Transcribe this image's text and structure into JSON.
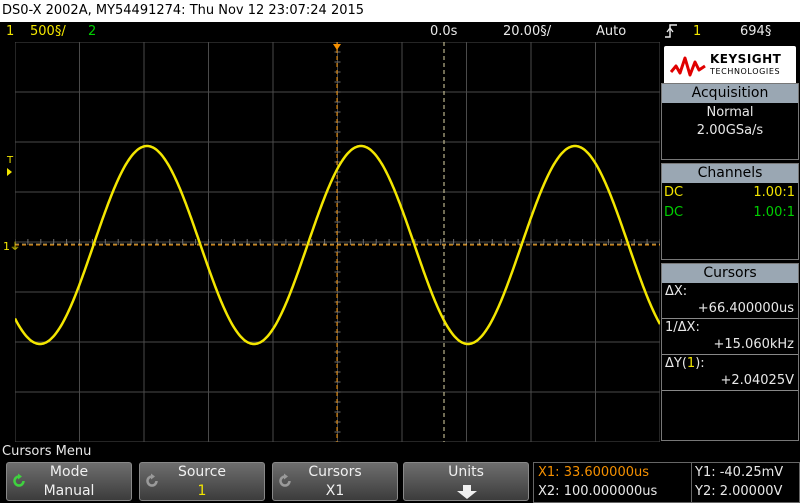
{
  "title": "DS0-X 2002A, MY54491274: Thu Nov 12 23:07:24 2015",
  "status": {
    "ch1_num": "1",
    "ch1_scale": "500§/",
    "ch2_num": "2",
    "time_delay": "0.0s",
    "time_scale": "20.00§/",
    "trigger_mode": "Auto",
    "trigger_icon": "rising-edge-trigger",
    "trigger_source": "1",
    "trigger_level": "694§"
  },
  "graticule": {
    "trigger_marker": "T",
    "ground_marker": "1"
  },
  "logo": {
    "line1": "KEYSIGHT",
    "line2": "TECHNOLOGIES"
  },
  "acquisition": {
    "header": "Acquisition",
    "mode": "Normal",
    "rate": "2.00GSa/s"
  },
  "channels": {
    "header": "Channels",
    "rows": [
      {
        "coupling": "DC",
        "probe": "1.00:1",
        "color": "#f3e600"
      },
      {
        "coupling": "DC",
        "probe": "1.00:1",
        "color": "#00d000"
      }
    ]
  },
  "cursors": {
    "header": "Cursors",
    "dx_label": "ΔX:",
    "dx_value": "+66.400000us",
    "inv_dx_label": "1/ΔX:",
    "inv_dx_value": "+15.060kHz",
    "dy_label_prefix": "ΔY(",
    "dy_label_src": "1",
    "dy_label_suffix": "):",
    "dy_value": "+2.04025V"
  },
  "menu": {
    "title": "Cursors Menu",
    "keys": [
      {
        "top": "Mode",
        "bottom": "Manual"
      },
      {
        "top": "Source",
        "bottom": "1"
      },
      {
        "top": "Cursors",
        "bottom": "X1"
      },
      {
        "top": "Units",
        "bottom": ""
      }
    ]
  },
  "readout": {
    "x1": "X1: 33.600000us",
    "x2": "X2: 100.000000us",
    "y1": "Y1: -40.25mV",
    "y2": "Y2: 2.00000V"
  },
  "colors": {
    "ch1": "#f3e600",
    "ch2": "#00d000",
    "cursor_x1": "#f59000",
    "cursor_x2": "#e0d8a8",
    "panel_header": "#9aa7b3",
    "logo_red": "#e00000"
  }
}
